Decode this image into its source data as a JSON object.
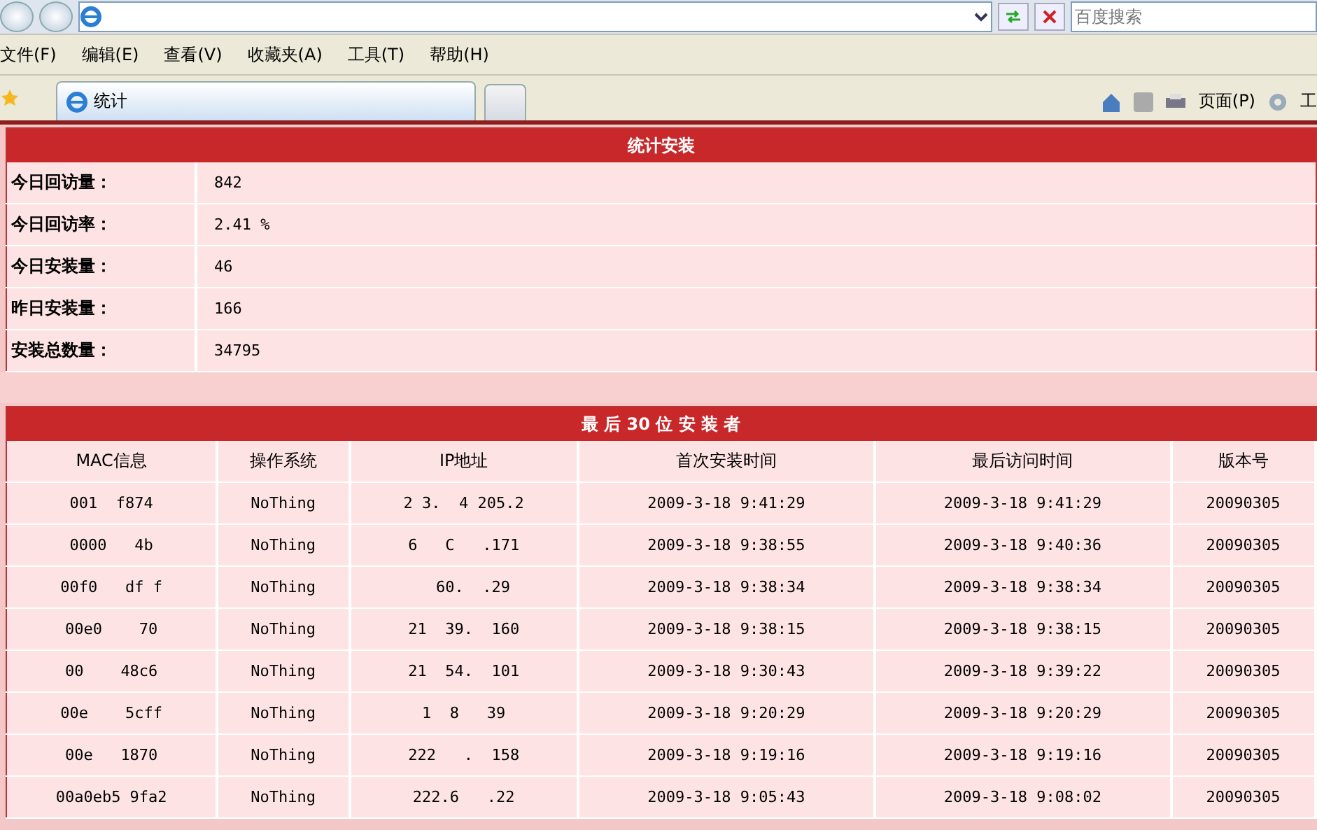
{
  "browser": {
    "search_placeholder": "百度搜索",
    "menu": [
      "文件(F)",
      "编辑(E)",
      "查看(V)",
      "收藏夹(A)",
      "工具(T)",
      "帮助(H)"
    ],
    "tab_title": "统计",
    "page_menu": "页面(P)",
    "tools_menu": "工"
  },
  "summary": {
    "title": "统计安装",
    "rows": [
      {
        "label": "今日回访量：",
        "value": "842"
      },
      {
        "label": "今日回访率：",
        "value": "2.41 %"
      },
      {
        "label": "今日安装量：",
        "value": "46"
      },
      {
        "label": "昨日安装量：",
        "value": "166"
      },
      {
        "label": "安装总数量：",
        "value": "34795"
      }
    ]
  },
  "installers": {
    "title": "最 后 30 位 安 装 者",
    "columns": [
      "MAC信息",
      "操作系统",
      "IP地址",
      "首次安装时间",
      "最后访问时间",
      "版本号"
    ],
    "rows": [
      [
        "001  f874",
        "NoThing",
        "2 3.  4 205.2",
        "2009-3-18 9:41:29",
        "2009-3-18 9:41:29",
        "20090305"
      ],
      [
        "0000   4b",
        "NoThing",
        "6   C   .171",
        "2009-3-18 9:38:55",
        "2009-3-18 9:40:36",
        "20090305"
      ],
      [
        "00f0   df f",
        "NoThing",
        "  60.  .29",
        "2009-3-18 9:38:34",
        "2009-3-18 9:38:34",
        "20090305"
      ],
      [
        "00e0    70",
        "NoThing",
        "21  39.  160",
        "2009-3-18 9:38:15",
        "2009-3-18 9:38:15",
        "20090305"
      ],
      [
        "00    48c6",
        "NoThing",
        "21  54.  101",
        "2009-3-18 9:30:43",
        "2009-3-18 9:39:22",
        "20090305"
      ],
      [
        "00e    5cff",
        "NoThing",
        "1  8   39",
        "2009-3-18 9:20:29",
        "2009-3-18 9:20:29",
        "20090305"
      ],
      [
        "00e   1870",
        "NoThing",
        "222   .  158",
        "2009-3-18 9:19:16",
        "2009-3-18 9:19:16",
        "20090305"
      ],
      [
        "00a0eb5 9fa2",
        "NoThing",
        "222.6   .22",
        "2009-3-18 9:05:43",
        "2009-3-18 9:08:02",
        "20090305"
      ]
    ]
  }
}
